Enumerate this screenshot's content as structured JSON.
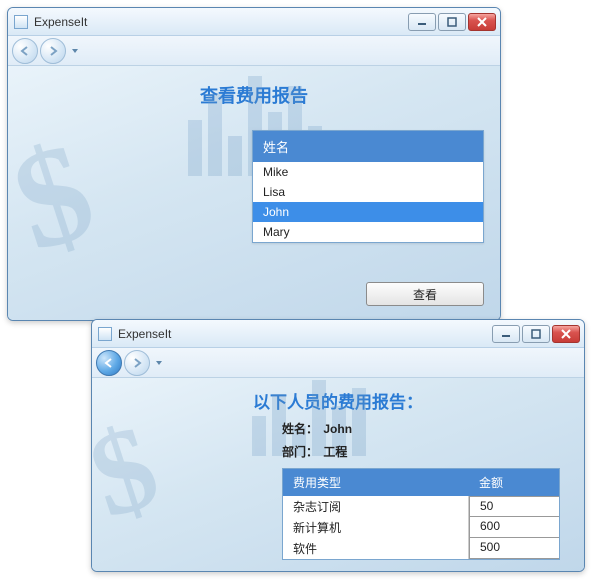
{
  "window1": {
    "title": "ExpenseIt",
    "heading": "查看费用报告",
    "list_header": "姓名",
    "names": [
      "Mike",
      "Lisa",
      "John",
      "Mary"
    ],
    "selected_index": 2,
    "view_button": "查看"
  },
  "window2": {
    "title": "ExpenseIt",
    "heading": "以下人员的费用报告：",
    "name_label": "姓名：",
    "name_value": "John",
    "dept_label": "部门：",
    "dept_value": "工程",
    "table": {
      "col_type": "费用类型",
      "col_amount": "金额",
      "rows": [
        {
          "type": "杂志订阅",
          "amount": "50"
        },
        {
          "type": "新计算机",
          "amount": "600"
        },
        {
          "type": "软件",
          "amount": "500"
        }
      ]
    }
  }
}
